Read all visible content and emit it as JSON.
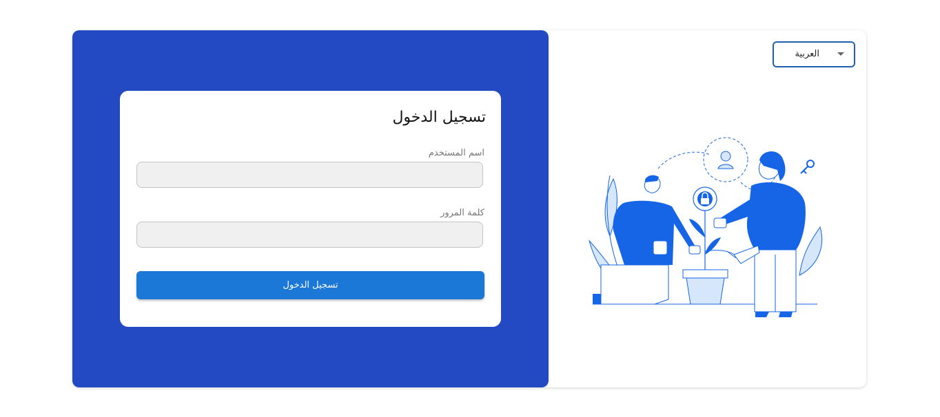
{
  "language_select": {
    "selected": "العربية",
    "icon": "chevron-down-icon"
  },
  "login_card": {
    "title": "تسجيل الدخول",
    "username_label": "اسم المستخدم",
    "username_value": "",
    "password_label": "كلمة المرور",
    "password_value": "",
    "submit_label": "تسجيل الدخول"
  },
  "colors": {
    "panel_blue": "#2349c3",
    "button_blue": "#1b78d6",
    "illustration_blue": "#1565e6",
    "illustration_light": "#d6e6fb"
  }
}
